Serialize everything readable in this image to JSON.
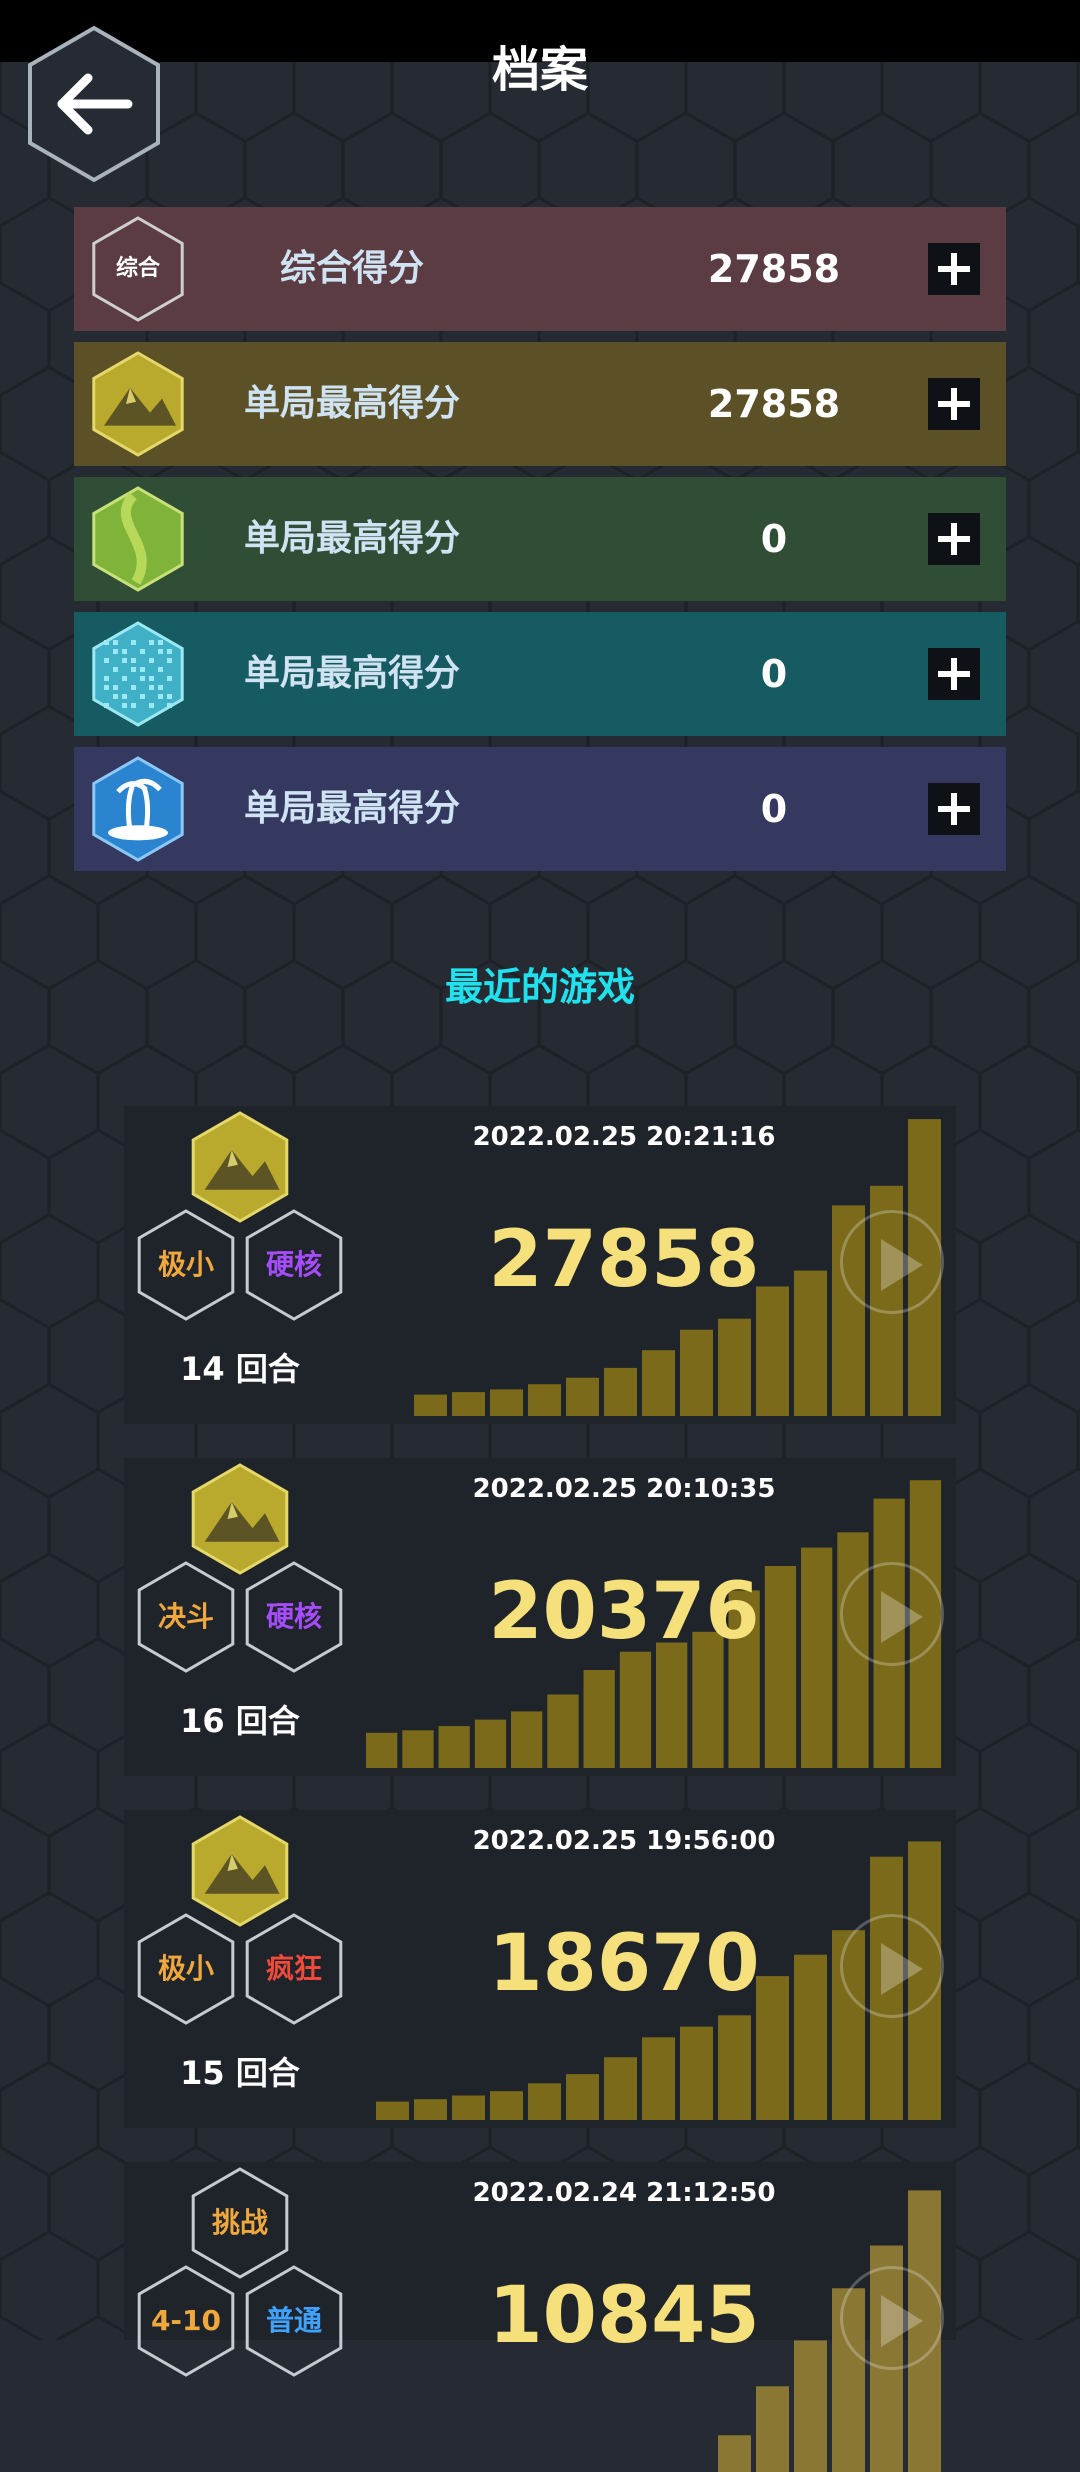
{
  "header": {
    "title": "档案"
  },
  "colors": {
    "background": "#262b33",
    "accent_cyan": "#20e2ee",
    "score_yellow": "#f5e07c",
    "bar_color": "#7a6a1a",
    "tag_orange": "#f0a73c",
    "tag_purple": "#a64cff",
    "tag_red": "#f04a3a",
    "tag_blue": "#3fa2ff"
  },
  "score_rows": [
    {
      "icon": "overall-hex-icon",
      "badge_text": "综合",
      "label": "综合得分",
      "value": "27858",
      "bg": "#5a3c42"
    },
    {
      "icon": "desert-map-icon",
      "badge_text": "",
      "label": "单局最高得分",
      "value": "27858",
      "bg": "#5c5126"
    },
    {
      "icon": "grassland-map-icon",
      "badge_text": "",
      "label": "单局最高得分",
      "value": "0",
      "bg": "#2f4e35"
    },
    {
      "icon": "world-map-icon",
      "badge_text": "",
      "label": "单局最高得分",
      "value": "0",
      "bg": "#165a62"
    },
    {
      "icon": "island-map-icon",
      "badge_text": "",
      "label": "单局最高得分",
      "value": "0",
      "bg": "#35385f"
    }
  ],
  "recent": {
    "title": "最近的游戏"
  },
  "games": [
    {
      "timestamp": "2022.02.25 20:21:16",
      "score": "27858",
      "rounds": "14 回合",
      "map_icon": "desert-map-icon",
      "tag_left": {
        "text": "极小",
        "color": "#f0a73c"
      },
      "tag_right": {
        "text": "硬核",
        "color": "#a64cff"
      },
      "progression": [
        700,
        780,
        870,
        1040,
        1250,
        1570,
        2150,
        2820,
        3180,
        4230,
        4750,
        6880,
        7520,
        9700
      ]
    },
    {
      "timestamp": "2022.02.25 20:10:35",
      "score": "20376",
      "rounds": "16 回合",
      "map_icon": "desert-map-icon",
      "tag_left": {
        "text": "决斗",
        "color": "#f0a73c"
      },
      "tag_right": {
        "text": "硬核",
        "color": "#a64cff"
      },
      "progression": [
        1150,
        1230,
        1370,
        1580,
        1850,
        2400,
        3200,
        3800,
        4100,
        4450,
        5800,
        6600,
        7200,
        7700,
        8800,
        9400
      ]
    },
    {
      "timestamp": "2022.02.25 19:56:00",
      "score": "18670",
      "rounds": "15 回合",
      "map_icon": "desert-map-icon",
      "tag_left": {
        "text": "极小",
        "color": "#f0a73c"
      },
      "tag_right": {
        "text": "疯狂",
        "color": "#f04a3a"
      },
      "progression": [
        600,
        680,
        800,
        940,
        1200,
        1500,
        2050,
        2700,
        3050,
        3420,
        4700,
        5400,
        6200,
        8600,
        9100
      ]
    },
    {
      "timestamp": "2022.02.24 21:12:50",
      "score": "10845",
      "rounds": "",
      "map_icon": "",
      "tag_top": {
        "text": "挑战",
        "color": "#f0a73c"
      },
      "tag_left": {
        "text": "4-10",
        "color": "#f0a73c"
      },
      "tag_right": {
        "text": "普通",
        "color": "#3fa2ff"
      },
      "progression": [
        1200,
        2800,
        4300,
        6000,
        7400,
        9200
      ]
    }
  ]
}
